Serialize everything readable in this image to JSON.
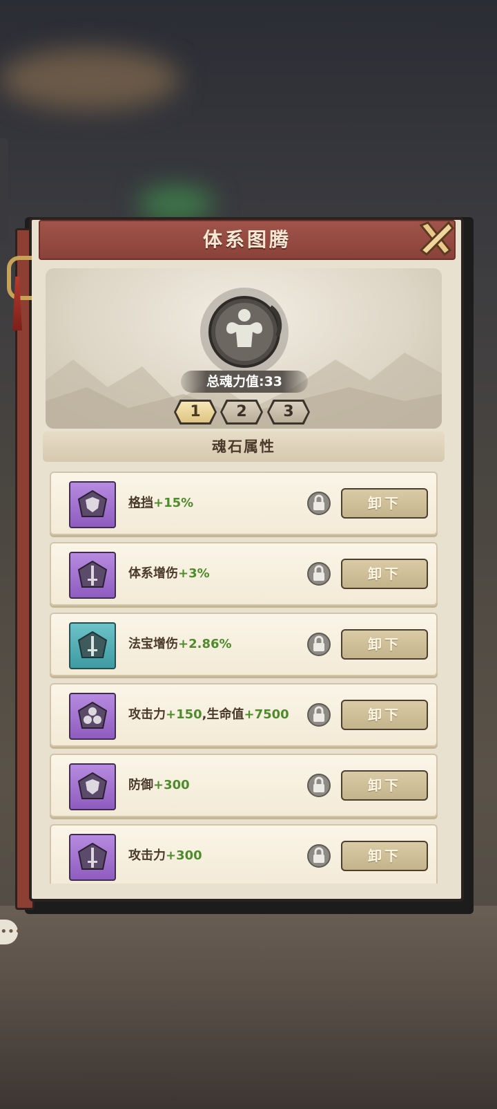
{
  "dialog": {
    "title": "体系图腾",
    "total_power_label": "总魂力值:33",
    "page_tabs": [
      {
        "label": "1",
        "active": true
      },
      {
        "label": "2",
        "active": false
      },
      {
        "label": "3",
        "active": false
      }
    ],
    "section_title": "魂石属性",
    "unequip_label": "卸下",
    "stones": [
      {
        "name": "格挡",
        "value": "+15%",
        "gem_color": "purple",
        "icon": "shield-icon",
        "underline": true
      },
      {
        "name": "体系增伤",
        "value": "+3%",
        "gem_color": "purple",
        "icon": "sword-icon"
      },
      {
        "name": "法宝增伤",
        "value": "+2.86%",
        "gem_color": "teal",
        "icon": "sword-icon"
      },
      {
        "name": "攻击力",
        "value": "+150",
        "name2": ",生命值",
        "value2": "+7500",
        "gem_color": "purple",
        "icon": "triple-orb-icon"
      },
      {
        "name": "防御",
        "value": "+300",
        "gem_color": "purple",
        "icon": "shield-icon"
      },
      {
        "name": "攻击力",
        "value": "+300",
        "gem_color": "purple",
        "icon": "sword-icon"
      }
    ]
  },
  "colors": {
    "header": "#8a4238",
    "value_green": "#4d8b2c",
    "gem_purple": "#8e5cbf",
    "gem_teal": "#3f9aa2"
  }
}
